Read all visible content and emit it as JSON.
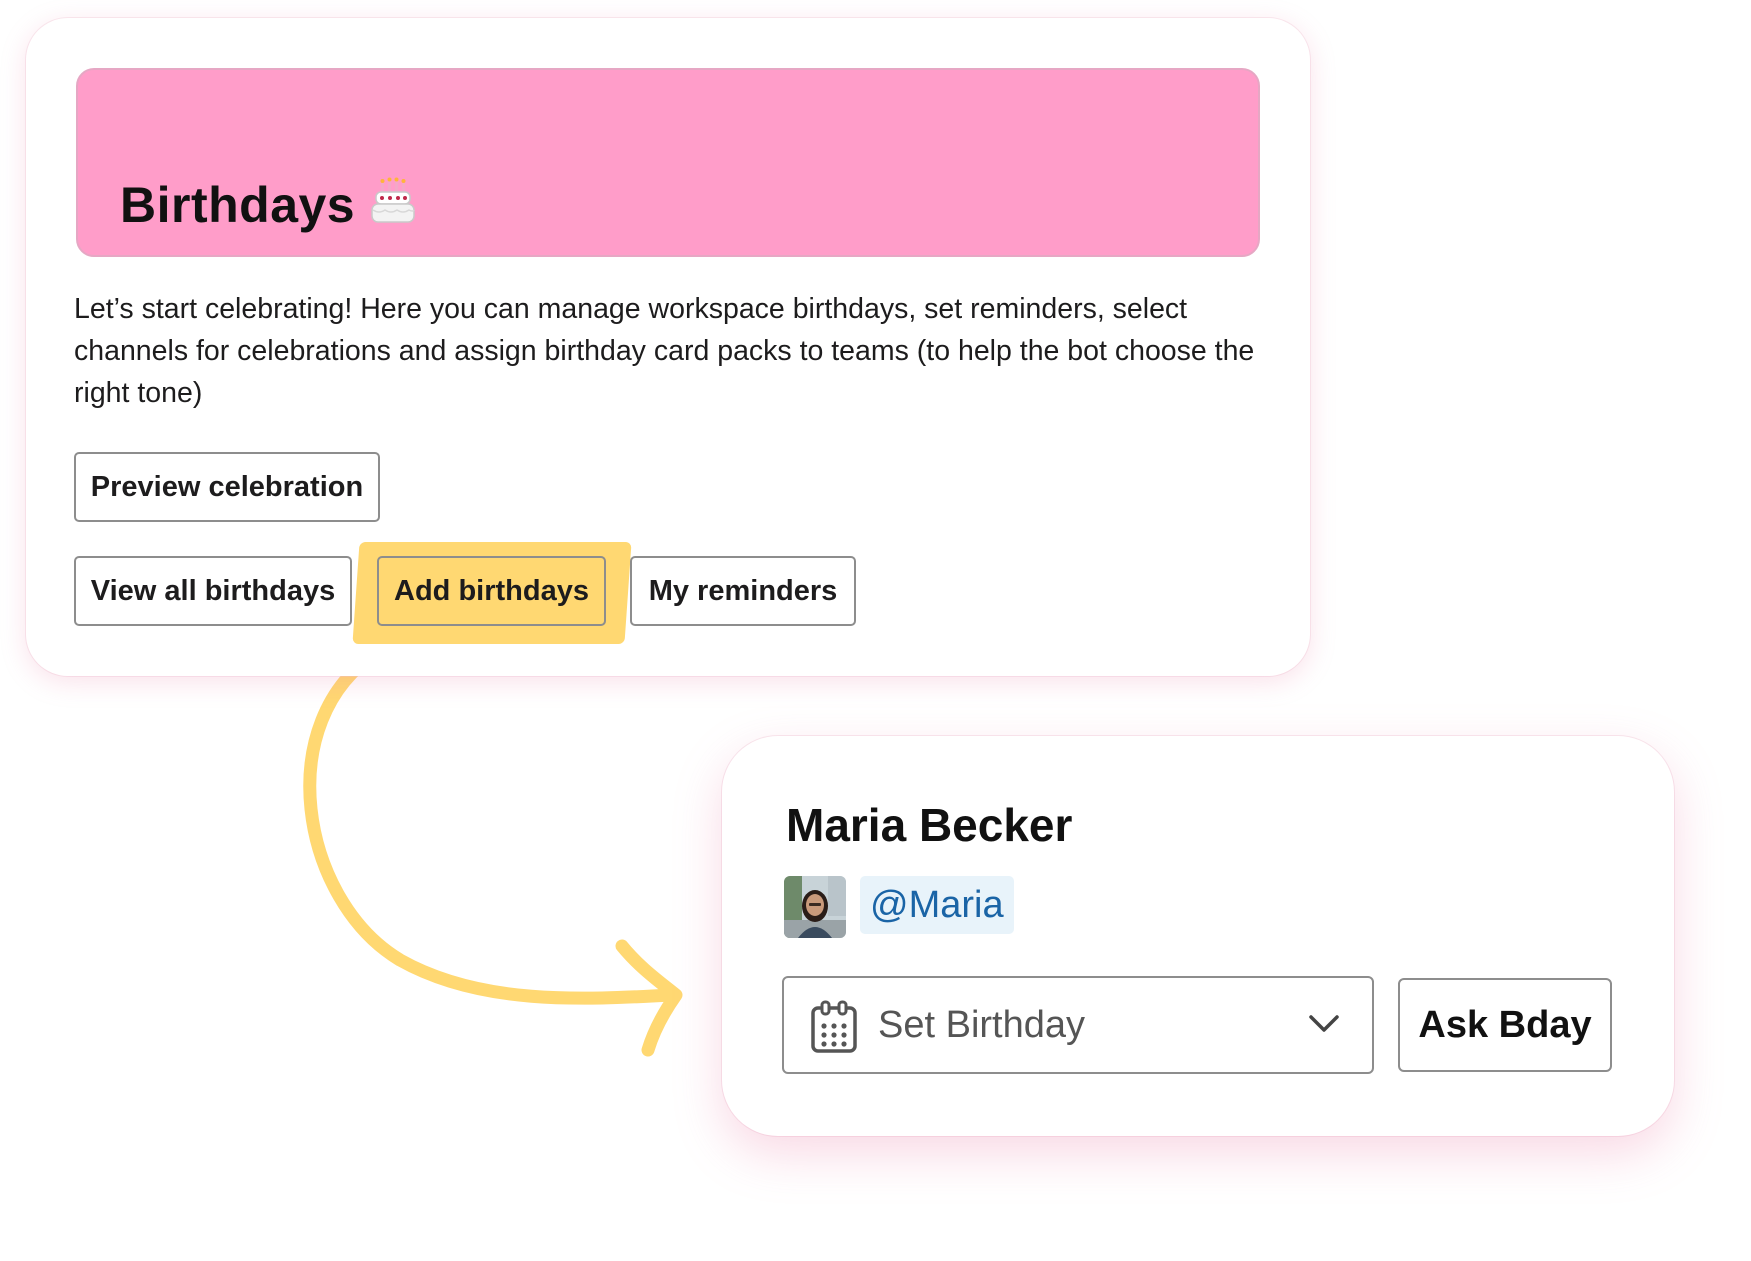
{
  "birthdays_card": {
    "title": "Birthdays",
    "title_icon": "birthday-cake-icon",
    "banner_color": "#ff9dc9",
    "intro": "Let’s start celebrating! Here you can manage workspace birthdays, set reminders, select channels for celebrations and assign birthday card packs to teams (to help the bot choose the right tone)",
    "buttons": {
      "preview": "Preview celebration",
      "view_all": "View all birthdays",
      "add": "Add birthdays",
      "reminders": "My reminders"
    },
    "highlight_color": "#ffd872"
  },
  "user_card": {
    "name": "Maria Becker",
    "avatar": "user-avatar-photo",
    "mention": "@Maria",
    "select": {
      "icon": "calendar-icon",
      "label": "Set Birthday",
      "chevron": "chevron-down-icon"
    },
    "ask_button": "Ask Bday"
  },
  "colors": {
    "accent_yellow": "#ffd872",
    "banner_pink": "#ff9dc9",
    "mention_blue": "#1a64a6",
    "mention_bg": "#e8f3fa"
  }
}
